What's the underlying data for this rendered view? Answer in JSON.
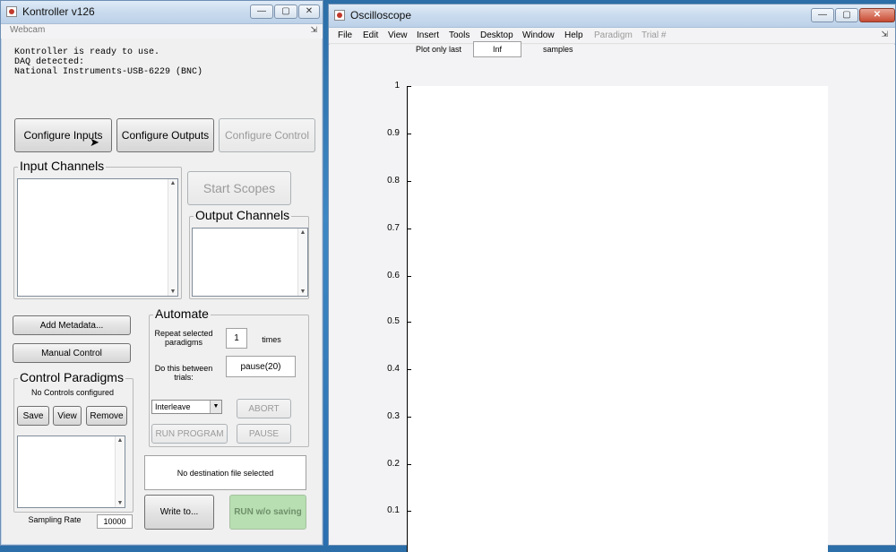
{
  "kontroller": {
    "title": "Kontroller v126",
    "menu_label": "Webcam",
    "pin_icon": "pin-icon",
    "status_lines": [
      "Kontroller is ready to use.",
      "DAQ detected:",
      "National Instruments-USB-6229 (BNC)"
    ],
    "configure_inputs": "Configure Inputs",
    "configure_outputs": "Configure Outputs",
    "configure_control": "Configure Control",
    "input_channels": "Input Channels",
    "start_scopes": "Start Scopes",
    "output_channels": "Output Channels",
    "add_metadata": "Add Metadata...",
    "manual_control": "Manual Control",
    "control_paradigms": {
      "title": "Control Paradigms",
      "status": "No Controls configured",
      "save": "Save",
      "view": "View",
      "remove": "Remove"
    },
    "automate": {
      "title": "Automate",
      "repeat_label": "Repeat selected paradigms",
      "repeat_value": "1",
      "times_label": "times",
      "between_label": "Do this between trials:",
      "between_value": "pause(20)",
      "mode_select": "Interleave",
      "abort": "ABORT",
      "run_program": "RUN PROGRAM",
      "pause": "PAUSE"
    },
    "destination": "No destination file selected",
    "write_to": "Write to...",
    "run_without_saving": "RUN w/o saving",
    "sampling_rate_label": "Sampling Rate",
    "sampling_rate_value": "10000"
  },
  "oscilloscope": {
    "title": "Oscilloscope",
    "menus": [
      "File",
      "Edit",
      "View",
      "Insert",
      "Tools",
      "Desktop",
      "Window",
      "Help",
      "Paradigm",
      "Trial #"
    ],
    "disabled_menus": [
      "Paradigm",
      "Trial #"
    ],
    "plot_only_last_label": "Plot only last",
    "plot_only_last_value": "Inf",
    "samples_label": "samples",
    "y_ticks": [
      "1",
      "0.9",
      "0.8",
      "0.7",
      "0.6",
      "0.5",
      "0.4",
      "0.3",
      "0.2",
      "0.1"
    ]
  },
  "colors": {
    "desktop": "#2f7bbf",
    "window_face": "#f0f0f0",
    "run_button": "#b7dfb1"
  }
}
